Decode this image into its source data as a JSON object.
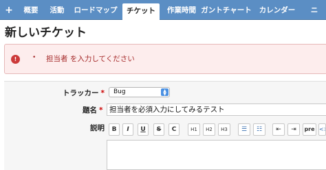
{
  "nav": {
    "items": [
      {
        "label": "+"
      },
      {
        "label": "概要"
      },
      {
        "label": "活動"
      },
      {
        "label": "ロードマップ"
      },
      {
        "label": "チケット"
      },
      {
        "label": "作業時間"
      },
      {
        "label": "ガントチャート"
      },
      {
        "label": "カレンダー"
      },
      {
        "label": "ニ"
      }
    ],
    "active_label": "チケット"
  },
  "page": {
    "title": "新しいチケット"
  },
  "error": {
    "icon": "!",
    "bullet": "•",
    "message": "担当者 を入力してください"
  },
  "form": {
    "tracker": {
      "label": "トラッカー",
      "required_mark": "*",
      "value": "Bug"
    },
    "subject": {
      "label": "題名",
      "required_mark": "*",
      "value": "担当者を必須入力にしてみるテスト"
    },
    "description": {
      "label": "説明"
    }
  },
  "toolbar": {
    "buttons": [
      {
        "label": "B",
        "icon": "bold-icon"
      },
      {
        "label": "I",
        "icon": "italic-icon"
      },
      {
        "label": "U",
        "icon": "underline-icon"
      },
      {
        "label": "S",
        "icon": "strikethrough-icon"
      },
      {
        "label": "C",
        "icon": "code-icon"
      },
      {
        "label": "H1",
        "icon": "heading1-icon"
      },
      {
        "label": "H2",
        "icon": "heading2-icon"
      },
      {
        "label": "H3",
        "icon": "heading3-icon"
      },
      {
        "label": "☰",
        "icon": "bulleted-list-icon"
      },
      {
        "label": "☷",
        "icon": "numbered-list-icon"
      },
      {
        "label": "⇤",
        "icon": "outdent-icon"
      },
      {
        "label": "⇥",
        "icon": "indent-icon"
      },
      {
        "label": "pre",
        "icon": "pre-icon"
      },
      {
        "label": "<>",
        "icon": "code-block-icon"
      }
    ]
  },
  "colors": {
    "nav_bg": "#5b8ec4",
    "error_bg": "#fdeded",
    "error_text": "#a52a2a",
    "required": "#cc0000",
    "select_arrow": "#4a90e2"
  }
}
